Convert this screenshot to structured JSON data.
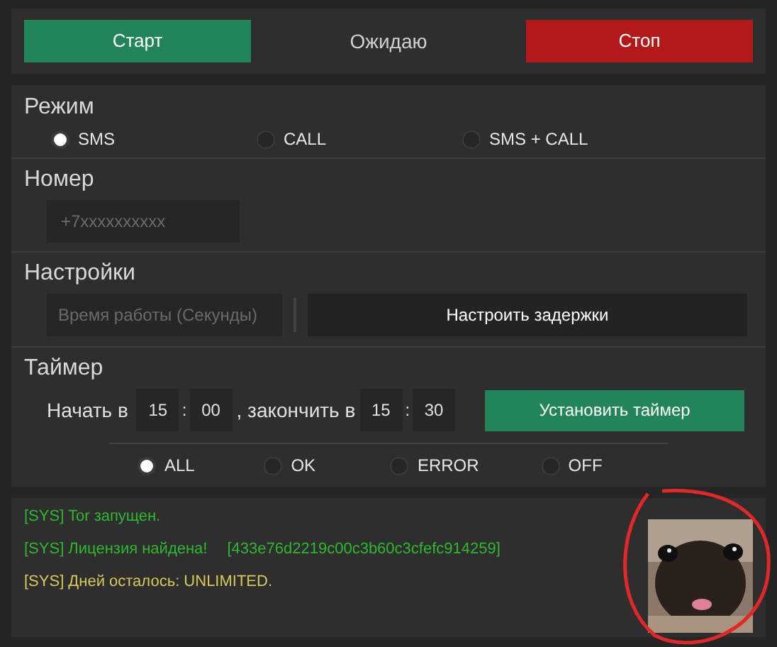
{
  "controls": {
    "start": "Старт",
    "status": "Ожидаю",
    "stop": "Стоп"
  },
  "mode": {
    "title": "Режим",
    "options": [
      {
        "label": "SMS",
        "selected": true
      },
      {
        "label": "CALL",
        "selected": false
      },
      {
        "label": "SMS + CALL",
        "selected": false
      }
    ]
  },
  "number": {
    "title": "Номер",
    "placeholder": "+7xxxxxxxxxx"
  },
  "settings": {
    "title": "Настройки",
    "placeholder": "Время работы (Секунды)",
    "button": "Настроить задержки"
  },
  "timer": {
    "title": "Таймер",
    "start_label": "Начать в",
    "start_hour": "15",
    "separator_1": ":",
    "start_minute": "00",
    "end_label": ", закончить в",
    "end_hour": "15",
    "separator_2": ":",
    "end_minute": "30",
    "button": "Установить таймер"
  },
  "filter": [
    {
      "label": "ALL",
      "selected": true
    },
    {
      "label": "OK",
      "selected": false
    },
    {
      "label": "ERROR",
      "selected": false
    },
    {
      "label": "OFF",
      "selected": false
    }
  ],
  "log": [
    {
      "parts": [
        "[SYS] Tor запущен."
      ],
      "color": "#2eb82e"
    },
    {
      "parts": [
        "[SYS] Лицензия найдена!",
        "[433e76d2219c00c3b60c3cfefc914259]"
      ],
      "color": "#2eb82e"
    },
    {
      "parts": [
        "[SYS] Дней осталось: UNLIMITED."
      ],
      "color": "#d8c85a"
    }
  ]
}
